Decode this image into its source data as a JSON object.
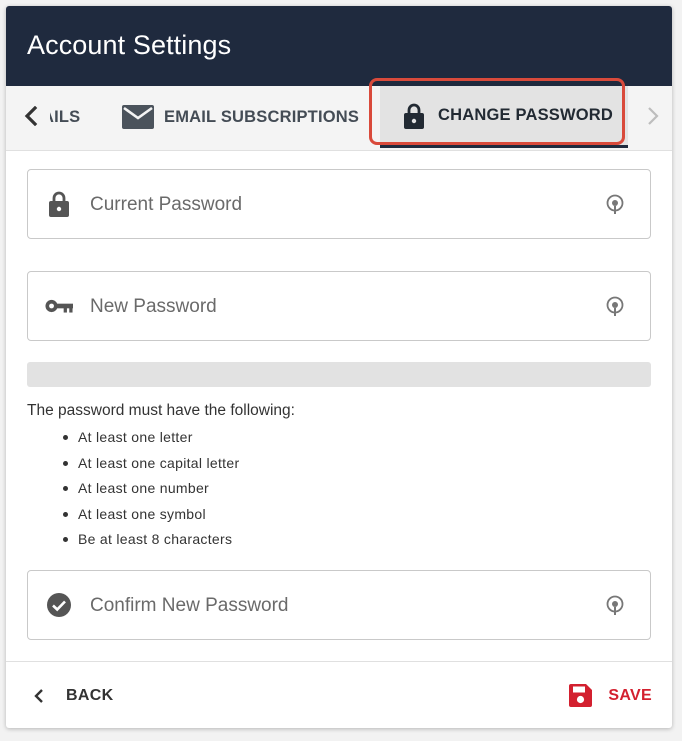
{
  "header": {
    "title": "Account Settings"
  },
  "tabs": {
    "prev_icon": "chevron-left-icon",
    "next_icon": "chevron-right-icon",
    "items": [
      {
        "label": "AILS",
        "icon": "",
        "state": "partial"
      },
      {
        "label": "EMAIL SUBSCRIPTIONS",
        "icon": "envelope-icon",
        "state": "inactive"
      },
      {
        "label": "CHANGE PASSWORD",
        "icon": "lock-icon",
        "state": "active"
      }
    ]
  },
  "form": {
    "current_password": {
      "placeholder": "Current Password",
      "value": "",
      "icon": "lock-icon",
      "toggle_icon": "visibility-toggle-icon"
    },
    "new_password": {
      "placeholder": "New Password",
      "value": "",
      "icon": "key-icon",
      "toggle_icon": "visibility-toggle-icon"
    },
    "strength_level": 0,
    "requirements_title": "The password must have the following:",
    "requirements": [
      "At least one letter",
      "At least one capital letter",
      "At least one number",
      "At least one symbol",
      "Be at least 8 characters"
    ],
    "confirm_password": {
      "placeholder": "Confirm New Password",
      "value": "",
      "icon": "check-circle-icon",
      "toggle_icon": "visibility-toggle-icon"
    }
  },
  "footer": {
    "back_label": "BACK",
    "save_label": "SAVE"
  },
  "colors": {
    "header_bg": "#1f2a3e",
    "accent_red": "#d3202f",
    "highlight_outline": "#d94a3b"
  }
}
